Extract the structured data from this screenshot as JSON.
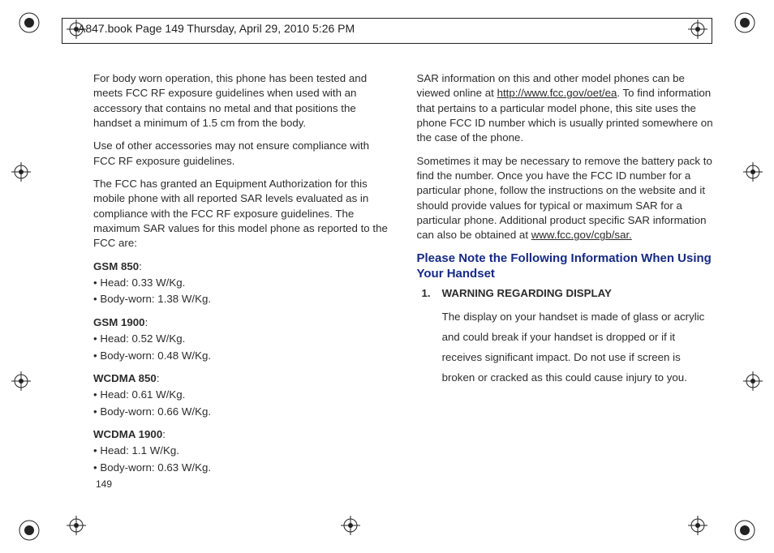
{
  "header": {
    "crop_line": "A847.book  Page 149  Thursday, April 29, 2010  5:26 PM"
  },
  "left_col": {
    "p1": "For body worn operation, this phone has been tested and meets FCC RF exposure guidelines when used with an accessory that contains no metal and that positions the handset a minimum of 1.5 cm from the body.",
    "p2": "Use of other accessories may not ensure compliance with FCC RF exposure guidelines.",
    "p3": "The FCC has granted an Equipment Authorization for this mobile phone with all reported SAR levels evaluated as in compliance with the FCC RF exposure guidelines. The maximum SAR values for this model phone as reported to the FCC are:",
    "gsm850_label": "GSM 850",
    "gsm850_head": "• Head: 0.33 W/Kg.",
    "gsm850_body": "• Body-worn: 1.38 W/Kg.",
    "gsm1900_label": "GSM 1900",
    "gsm1900_head": "• Head: 0.52 W/Kg.",
    "gsm1900_body": "• Body-worn: 0.48 W/Kg.",
    "wcdma850_label": "WCDMA 850",
    "wcdma850_head": "• Head: 0.61 W/Kg.",
    "wcdma850_body": "• Body-worn: 0.66 W/Kg.",
    "wcdma1900_label": "WCDMA 1900",
    "wcdma1900_head": "• Head: 1.1 W/Kg.",
    "wcdma1900_body": "• Body-worn: 0.63 W/Kg."
  },
  "right_col": {
    "p1_a": "SAR information on this and other model phones can be viewed online at ",
    "p1_link": "http://www.fcc.gov/oet/ea",
    "p1_b": ". To find information that pertains to a particular model phone, this site uses the phone FCC ID number which is usually printed somewhere on the case of the phone.",
    "p2_a": "Sometimes it may be necessary to remove the battery pack to find the number. Once you have the FCC ID number for a particular phone, follow the instructions on the website and it should provide values for typical or maximum SAR for a particular phone. Additional product specific SAR information can also be obtained at ",
    "p2_link": "www.fcc.gov/cgb/sar.",
    "section_head": "Please Note the Following Information When Using Your Handset",
    "item1_num": "1.",
    "item1_head": "WARNING REGARDING DISPLAY",
    "item1_body": "The display on your handset is made of glass or acrylic and could break if your handset is dropped or if it receives significant impact. Do not use if screen is broken or cracked as this could cause injury to you."
  },
  "page_number": "149"
}
